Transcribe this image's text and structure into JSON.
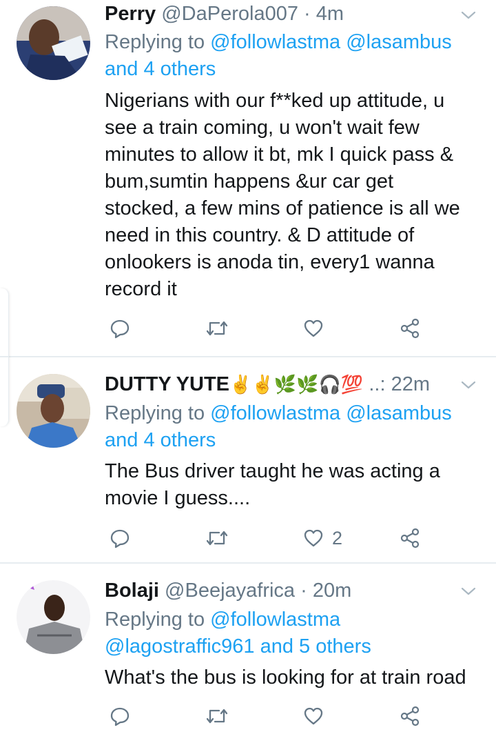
{
  "tweets": [
    {
      "name": "Perry",
      "handle": "@DaPerola007",
      "time": "· 4m",
      "replying_prefix": "Replying to ",
      "replying_line1": "@followlastma @lasambus",
      "replying_line2": "and 4 others",
      "body": "Nigerians with our f**ked up attitude, u\nsee a train coming, u won't wait few\nminutes to allow it bt, mk I quick pass &\nbum,sumtin happens &ur car get\nstocked, a few mins of patience is all we\nneed in this country. & D attitude of\nonlookers is anoda tin, every1 wanna\nrecord it",
      "likes": ""
    },
    {
      "name": "DUTTY YUTE",
      "name_emoji": "✌✌🌿🌿🎧💯",
      "handle": "..:",
      "time": "22m",
      "replying_prefix": "Replying to ",
      "replying_line1": "@followlastma @lasambus",
      "replying_line2": "and 4 others",
      "body": "The Bus driver taught he was acting a\nmovie I guess....",
      "likes": "2"
    },
    {
      "name": "Bolaji",
      "handle": "@Beejayafrica",
      "time": "· 20m",
      "replying_prefix": "Replying to ",
      "replying_line1": "@followlastma",
      "replying_line2": "@lagostraffic961 and 5 others",
      "body": "What's the bus is looking for at train road",
      "likes": ""
    }
  ],
  "icons": [
    "reply-icon",
    "retweet-icon",
    "like-icon",
    "share-icon",
    "chevron-down-icon"
  ],
  "colors": {
    "link": "#1da1f2",
    "muted": "#657786",
    "text": "#14171a",
    "divider": "#e6ecf0"
  }
}
